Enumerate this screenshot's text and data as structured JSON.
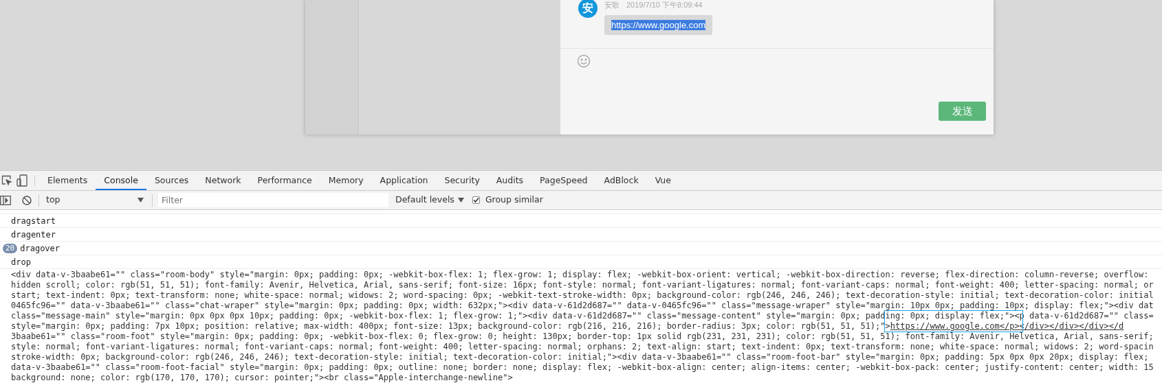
{
  "chat": {
    "message": {
      "avatar": "安",
      "sender": "安歌",
      "time": "2019/7/10 下午8:09:44",
      "text": "https://www.google.com",
      "selected": true
    },
    "send_button": "发送"
  },
  "devtools": {
    "tabs": [
      {
        "label": "Elements",
        "selected": false
      },
      {
        "label": "Console",
        "selected": true
      },
      {
        "label": "Sources",
        "selected": false
      },
      {
        "label": "Network",
        "selected": false
      },
      {
        "label": "Performance",
        "selected": false
      },
      {
        "label": "Memory",
        "selected": false
      },
      {
        "label": "Application",
        "selected": false
      },
      {
        "label": "Security",
        "selected": false
      },
      {
        "label": "Audits",
        "selected": false
      },
      {
        "label": "PageSpeed",
        "selected": false
      },
      {
        "label": "AdBlock",
        "selected": false
      },
      {
        "label": "Vue",
        "selected": false
      }
    ],
    "toolbar": {
      "context": "top",
      "filter_placeholder": "Filter",
      "levels": "Default levels",
      "group_similar": {
        "label": "Group similar",
        "checked": true
      }
    },
    "console": {
      "messages": [
        {
          "text": "dragstart"
        },
        {
          "text": "dragenter"
        },
        {
          "text": "dragover",
          "count": "20"
        },
        {
          "text": "drop"
        }
      ],
      "html_lines": [
        {
          "text": "<div data-v-3baabe61=\"\" class=\"room-body\" style=\"margin: 0px; padding: 0px; -webkit-box-flex: 1; flex-grow: 1; display: flex; -webkit-box-orient: vertical; -webkit-box-direction: reverse; flex-direction: column-reverse; overflow:"
        },
        {
          "text": "hidden scroll; color: rgb(51, 51, 51); font-family: Avenir, Helvetica, Arial, sans-serif; font-size: 16px; font-style: normal; font-variant-ligatures: normal; font-variant-caps: normal; font-weight: 400; letter-spacing: normal; or"
        },
        {
          "text": "start; text-indent: 0px; text-transform: none; white-space: normal; widows: 2; word-spacing: 0px; -webkit-text-stroke-width: 0px; background-color: rgb(246, 246, 246); text-decoration-style: initial; text-decoration-color: initial"
        },
        {
          "text": "0465fc96=\"\" data-v-3baabe61=\"\" class=\"chat-wraper\" style=\"margin: 0px; padding: 0px; width: 632px;\"><div data-v-61d2d687=\"\" data-v-0465fc96=\"\" class=\"message-wraper\" style=\"margin: 10px 0px; padding: 10px; display: flex;\"><div dat"
        },
        {
          "text": "class=\"message-main\" style=\"margin: 0px 0px 0px 10px; padding: 0px; -webkit-box-flex: 1; flex-grow: 1;\"><div data-v-61d2d687=\"\" class=\"message-content\" style=\"margin: 0px; padding: 0px; display: flex;\"><p data-v-61d2d687=\"\" class="
        },
        {
          "text": "style=\"margin: 0px; padding: 7px 10px; position: relative; max-width: 400px; font-size: 13px; background-color: rgb(216, 216, 216); border-radius: 3px; color: rgb(51, 51, 51);\">",
          "link": "https://www.google.com</p></div></div></div></d"
        },
        {
          "text": "3baabe61=\"\" class=\"room-foot\" style=\"margin: 0px; padding: 0px; -webkit-box-flex: 0; flex-grow: 0; height: 130px; border-top: 1px solid rgb(231, 231, 231); color: rgb(51, 51, 51); font-family: Avenir, Helvetica, Arial, sans-serif;"
        },
        {
          "text": "style: normal; font-variant-ligatures: normal; font-variant-caps: normal; font-weight: 400; letter-spacing: normal; orphans: 2; text-align: start; text-indent: 0px; text-transform: none; white-space: normal; widows: 2; word-spacin"
        },
        {
          "text": "stroke-width: 0px; background-color: rgb(246, 246, 246); text-decoration-style: initial; text-decoration-color: initial;\"><div data-v-3baabe61=\"\" class=\"room-foot-bar\" style=\"margin: 0px; padding: 5px 0px 0px 20px; display: flex;"
        },
        {
          "text": "data-v-3baabe61=\"\" class=\"room-foot-facial\" style=\"margin: 0px; padding: 0px; outline: none; border: none; display: flex; -webkit-box-align: center; align-items: center; -webkit-box-pack: center; justify-content: center; width: 15"
        },
        {
          "text": "background: none; color: rgb(170, 170, 170); cursor: pointer;\"><br class=\"Apple-interchange-newline\">"
        }
      ],
      "highlight_box": {
        "color": "#1aa3e8"
      }
    }
  }
}
